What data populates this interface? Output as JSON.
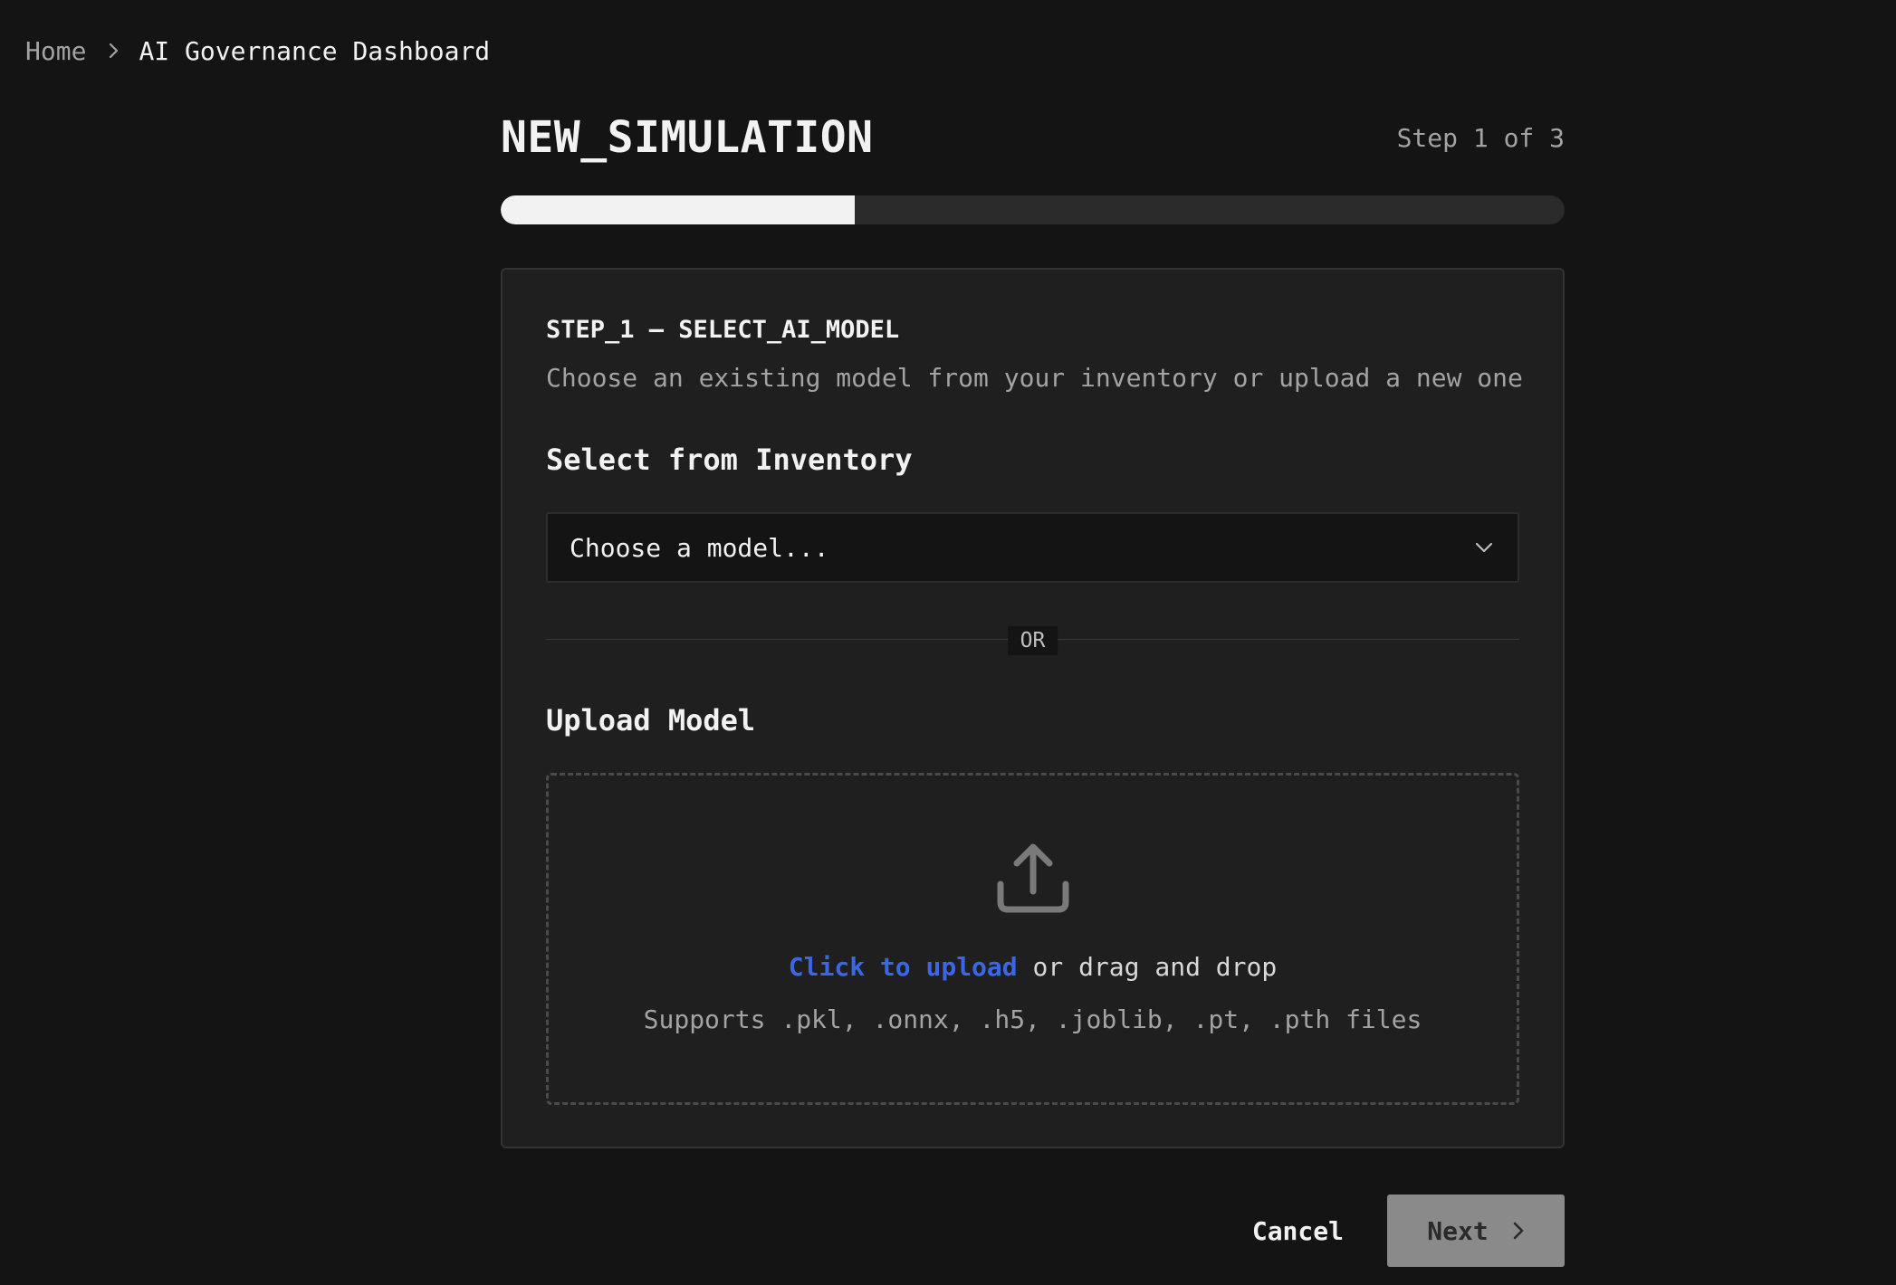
{
  "breadcrumb": {
    "home": "Home",
    "current": "AI Governance Dashboard"
  },
  "header": {
    "title": "NEW_SIMULATION",
    "step_indicator": "Step 1 of 3"
  },
  "progress": {
    "current_step": 1,
    "total_steps": 3,
    "fraction": 0.333
  },
  "step_card": {
    "title": "STEP_1 — SELECT_AI_MODEL",
    "description": "Choose an existing model from your inventory or upload a new one",
    "inventory": {
      "label": "Select from Inventory",
      "select_value": "Choose a model..."
    },
    "divider_text": "OR",
    "upload": {
      "label": "Upload Model",
      "link_text": "Click to upload",
      "rest_text": "or drag and drop",
      "hint": "Supports .pkl, .onnx, .h5, .joblib, .pt, .pth files"
    }
  },
  "actions": {
    "cancel_label": "Cancel",
    "next_label": "Next"
  },
  "icons": {
    "breadcrumb_separator": "chevron-right-icon",
    "select_chevron": "chevron-down-icon",
    "upload": "upload-icon",
    "next_arrow": "chevron-right-icon"
  },
  "colors": {
    "background": "#141414",
    "card": "#1f1f1f",
    "accent_link": "#3b66e6",
    "progress_fill": "#f2f2f2",
    "next_button_disabled": "#8a8a8a"
  }
}
